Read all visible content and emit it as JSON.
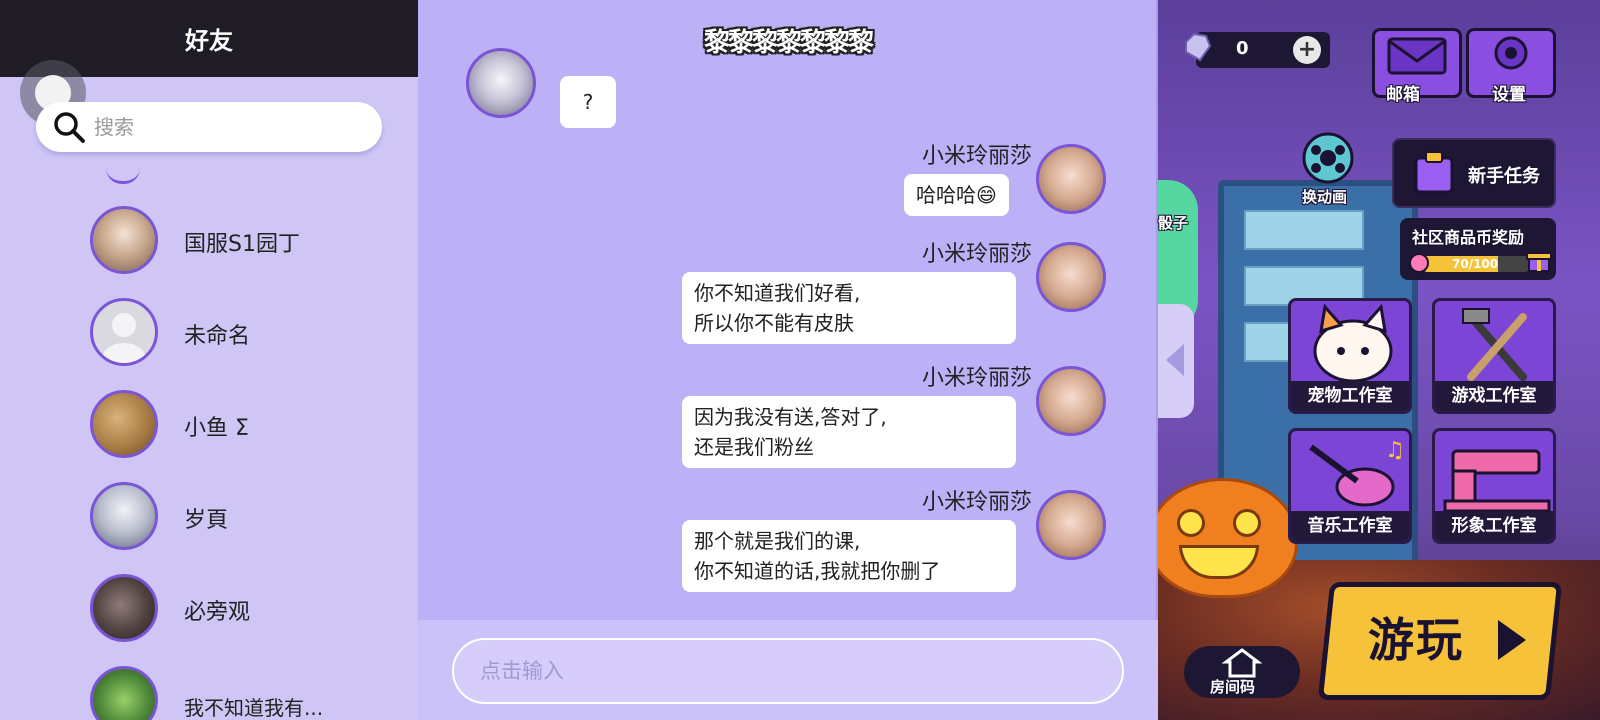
{
  "friends": {
    "title": "好友",
    "search_placeholder": "搜索",
    "items": [
      {
        "name": "国服S1园丁"
      },
      {
        "name": "未命名"
      },
      {
        "name": "小鱼 Σ"
      },
      {
        "name": "岁頁"
      },
      {
        "name": "必旁观"
      },
      {
        "name": "我不知道我有..."
      }
    ]
  },
  "chat": {
    "title": "黎黎黎黎黎黎黎",
    "messages": [
      {
        "sender": "",
        "lines": [
          "?"
        ]
      },
      {
        "sender": "小米玲丽莎",
        "lines": [
          "哈哈哈😄"
        ]
      },
      {
        "sender": "小米玲丽莎",
        "lines": [
          "你不知道我们好看,",
          "所以你不能有皮肤"
        ]
      },
      {
        "sender": "小米玲丽莎",
        "lines": [
          "因为我没有送,答对了,",
          "还是我们粉丝"
        ]
      },
      {
        "sender": "小米玲丽莎",
        "lines": [
          "那个就是我们的课,",
          "你不知道的话,我就把你删了"
        ]
      }
    ],
    "input_placeholder": "点击输入"
  },
  "game": {
    "currency_value": "0",
    "mail_label": "邮箱",
    "settings_label": "设置",
    "switch_anim_label": "换动画",
    "dice_label": "骰子",
    "newbie_task_label": "新手任务",
    "community_reward_label": "社区商品币奖励",
    "reward_progress_text": "70/100",
    "reward_progress": 0.7,
    "studios": [
      {
        "label": "宠物工作室"
      },
      {
        "label": "游戏工作室"
      },
      {
        "label": "音乐工作室"
      },
      {
        "label": "形象工作室"
      }
    ],
    "room_code_label": "房间码",
    "play_label": "游玩"
  },
  "colors": {
    "accent_purple": "#7b55d8",
    "chat_bg": "#bcb1f6",
    "friends_bg": "#cfc6f6",
    "header_dark": "#1f1c26",
    "play_yellow": "#f5c23a"
  }
}
